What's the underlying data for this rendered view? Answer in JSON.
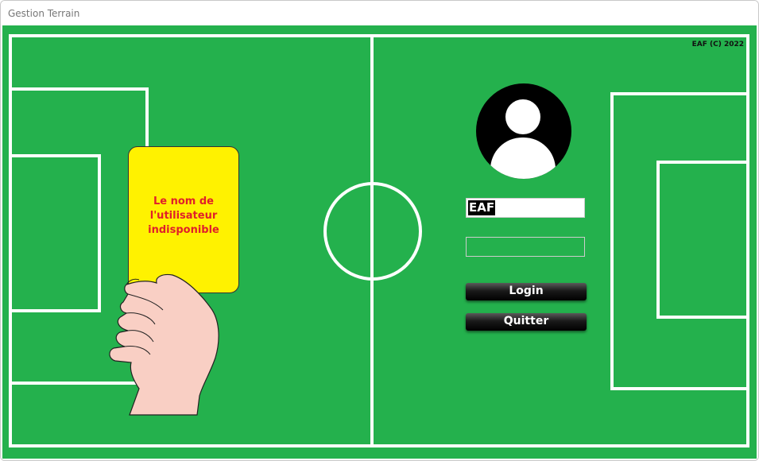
{
  "window": {
    "title": "Gestion Terrain"
  },
  "field": {
    "copyright": "EAF (C) 2022",
    "grass_color": "#24b14d"
  },
  "card": {
    "line1": "Le nom de",
    "line2": "l'utilisateur",
    "line3": "indisponible",
    "card_color": "#fff200",
    "text_color": "#e0202a"
  },
  "login": {
    "username_value": "EAF",
    "password_value": "",
    "login_label": "Login",
    "quit_label": "Quitter"
  },
  "icons": {
    "avatar": "user-avatar-icon",
    "hand": "hand-icon"
  }
}
